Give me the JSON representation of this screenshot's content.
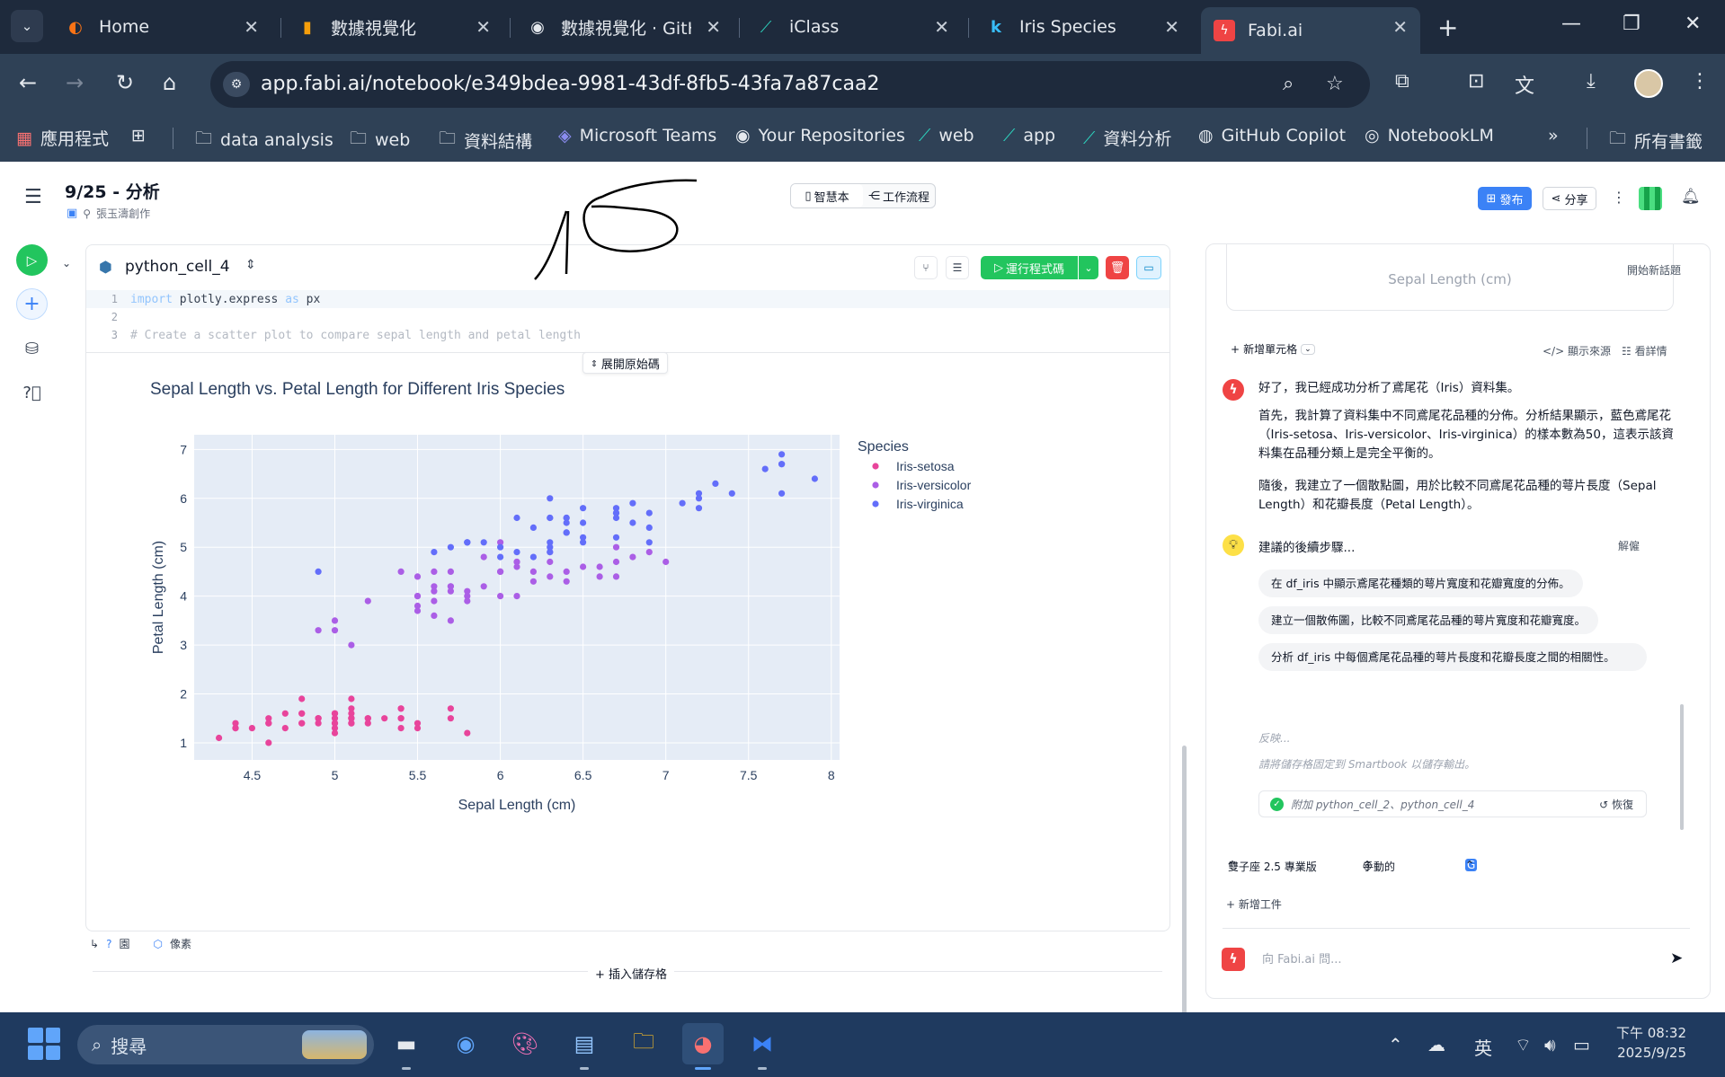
{
  "browser": {
    "tabs": [
      {
        "title": "Home",
        "icon": "home-tab-icon"
      },
      {
        "title": "數據視覺化",
        "icon": "book-icon"
      },
      {
        "title": "數據視覺化 · GitHub",
        "icon": "github-icon"
      },
      {
        "title": "iClass",
        "icon": "iclass-icon"
      },
      {
        "title": "Iris Species",
        "icon": "kaggle-icon"
      },
      {
        "title": "Fabi.ai",
        "icon": "fabi-icon"
      }
    ],
    "url": "app.fabi.ai/notebook/e349bdea-9981-43df-8fb5-43fa7a87caa2",
    "bookmarks": [
      {
        "label": "應用程式",
        "icon": "apps-grid-icon"
      },
      {
        "label": "data analysis",
        "icon": "folder-icon"
      },
      {
        "label": "web",
        "icon": "folder-icon"
      },
      {
        "label": "資料結構",
        "icon": "folder-icon"
      },
      {
        "label": "Microsoft Teams",
        "icon": "teams-icon"
      },
      {
        "label": "Your Repositories",
        "icon": "github-icon"
      },
      {
        "label": "web",
        "icon": "iclass-icon"
      },
      {
        "label": "app",
        "icon": "iclass-icon"
      },
      {
        "label": "資料分析",
        "icon": "iclass-icon"
      },
      {
        "label": "GitHub Copilot",
        "icon": "copilot-icon"
      },
      {
        "label": "NotebookLM",
        "icon": "notebooklm-icon"
      }
    ],
    "all_bookmarks": "所有書籤"
  },
  "app": {
    "notebook_title": "9/25 - 分析",
    "creator": "張玉濤創作",
    "view_tabs": [
      "智慧本",
      "工作流程"
    ],
    "publish": "發布",
    "share": "分享"
  },
  "cell": {
    "name": "python_cell_4",
    "run_label": "運行程式碼",
    "code_lines": [
      {
        "num": "1",
        "kw1": "import",
        "text1": " plotly.express ",
        "kw2": "as",
        "text2": " px"
      },
      {
        "num": "2",
        "text": ""
      },
      {
        "num": "3",
        "text": "# Create a scatter plot to compare sepal length and petal length"
      }
    ],
    "expand_source": "展開原始碼",
    "footer_ref": "園",
    "footer_pixels": "像素",
    "insert_cell": "插入儲存格"
  },
  "chart_data": {
    "type": "scatter",
    "title": "Sepal Length vs. Petal Length for Different Iris Species",
    "xlabel": "Sepal Length (cm)",
    "ylabel": "Petal Length (cm)",
    "xlim": [
      4.15,
      8.05
    ],
    "ylim": [
      0.65,
      7.3
    ],
    "xticks": [
      4.5,
      5,
      5.5,
      6,
      6.5,
      7,
      7.5,
      8
    ],
    "yticks": [
      1,
      2,
      3,
      4,
      5,
      6,
      7
    ],
    "grid": true,
    "legend_title": "Species",
    "legend_position": "top-right",
    "series": [
      {
        "name": "Iris-setosa",
        "color": "#e8449b",
        "points": [
          [
            5.1,
            1.4
          ],
          [
            4.9,
            1.4
          ],
          [
            4.7,
            1.3
          ],
          [
            4.6,
            1.5
          ],
          [
            5.0,
            1.4
          ],
          [
            5.4,
            1.7
          ],
          [
            4.6,
            1.4
          ],
          [
            5.0,
            1.5
          ],
          [
            4.4,
            1.4
          ],
          [
            4.9,
            1.5
          ],
          [
            5.4,
            1.5
          ],
          [
            4.8,
            1.6
          ],
          [
            4.8,
            1.4
          ],
          [
            4.3,
            1.1
          ],
          [
            5.8,
            1.2
          ],
          [
            5.7,
            1.5
          ],
          [
            5.4,
            1.3
          ],
          [
            5.1,
            1.4
          ],
          [
            5.7,
            1.7
          ],
          [
            5.1,
            1.5
          ],
          [
            5.4,
            1.7
          ],
          [
            5.1,
            1.5
          ],
          [
            4.6,
            1.0
          ],
          [
            5.1,
            1.7
          ],
          [
            4.8,
            1.9
          ],
          [
            5.0,
            1.6
          ],
          [
            5.0,
            1.6
          ],
          [
            5.2,
            1.5
          ],
          [
            5.2,
            1.4
          ],
          [
            4.7,
            1.6
          ],
          [
            4.8,
            1.6
          ],
          [
            5.4,
            1.5
          ],
          [
            5.2,
            1.5
          ],
          [
            5.5,
            1.4
          ],
          [
            4.9,
            1.5
          ],
          [
            5.0,
            1.2
          ],
          [
            5.5,
            1.3
          ],
          [
            4.9,
            1.5
          ],
          [
            4.4,
            1.3
          ],
          [
            5.1,
            1.5
          ],
          [
            5.0,
            1.3
          ],
          [
            4.5,
            1.3
          ],
          [
            4.4,
            1.3
          ],
          [
            5.0,
            1.6
          ],
          [
            5.1,
            1.9
          ],
          [
            4.8,
            1.4
          ],
          [
            5.1,
            1.6
          ],
          [
            4.6,
            1.4
          ],
          [
            5.3,
            1.5
          ],
          [
            5.0,
            1.4
          ]
        ]
      },
      {
        "name": "Iris-versicolor",
        "color": "#ab5ee6",
        "points": [
          [
            7.0,
            4.7
          ],
          [
            6.4,
            4.5
          ],
          [
            6.9,
            4.9
          ],
          [
            5.5,
            4.0
          ],
          [
            6.5,
            4.6
          ],
          [
            5.7,
            4.5
          ],
          [
            6.3,
            4.7
          ],
          [
            4.9,
            3.3
          ],
          [
            6.6,
            4.6
          ],
          [
            5.2,
            3.9
          ],
          [
            5.0,
            3.5
          ],
          [
            5.9,
            4.2
          ],
          [
            6.0,
            4.0
          ],
          [
            6.1,
            4.7
          ],
          [
            5.6,
            3.6
          ],
          [
            6.7,
            4.4
          ],
          [
            5.6,
            4.5
          ],
          [
            5.8,
            4.1
          ],
          [
            6.2,
            4.5
          ],
          [
            5.6,
            3.9
          ],
          [
            5.9,
            4.8
          ],
          [
            6.1,
            4.0
          ],
          [
            6.3,
            4.9
          ],
          [
            6.1,
            4.7
          ],
          [
            6.4,
            4.3
          ],
          [
            6.6,
            4.4
          ],
          [
            6.8,
            4.8
          ],
          [
            6.7,
            5.0
          ],
          [
            6.0,
            4.5
          ],
          [
            5.7,
            3.5
          ],
          [
            5.5,
            3.8
          ],
          [
            5.5,
            3.7
          ],
          [
            5.8,
            3.9
          ],
          [
            6.0,
            5.1
          ],
          [
            5.4,
            4.5
          ],
          [
            6.0,
            4.5
          ],
          [
            6.7,
            4.7
          ],
          [
            6.3,
            4.4
          ],
          [
            5.6,
            4.1
          ],
          [
            5.5,
            4.0
          ],
          [
            5.5,
            4.4
          ],
          [
            6.1,
            4.6
          ],
          [
            5.8,
            4.0
          ],
          [
            5.0,
            3.3
          ],
          [
            5.6,
            4.2
          ],
          [
            5.7,
            4.2
          ],
          [
            5.7,
            4.2
          ],
          [
            6.2,
            4.3
          ],
          [
            5.1,
            3.0
          ],
          [
            5.7,
            4.1
          ]
        ]
      },
      {
        "name": "Iris-virginica",
        "color": "#636efa",
        "points": [
          [
            6.3,
            6.0
          ],
          [
            5.8,
            5.1
          ],
          [
            7.1,
            5.9
          ],
          [
            6.3,
            5.6
          ],
          [
            6.5,
            5.8
          ],
          [
            7.6,
            6.6
          ],
          [
            4.9,
            4.5
          ],
          [
            7.3,
            6.3
          ],
          [
            6.7,
            5.8
          ],
          [
            7.2,
            6.1
          ],
          [
            6.5,
            5.1
          ],
          [
            6.4,
            5.3
          ],
          [
            6.8,
            5.5
          ],
          [
            5.7,
            5.0
          ],
          [
            5.8,
            5.1
          ],
          [
            6.4,
            5.3
          ],
          [
            6.5,
            5.5
          ],
          [
            7.7,
            6.7
          ],
          [
            7.7,
            6.9
          ],
          [
            6.0,
            5.0
          ],
          [
            6.9,
            5.7
          ],
          [
            5.6,
            4.9
          ],
          [
            7.7,
            6.7
          ],
          [
            6.3,
            4.9
          ],
          [
            6.7,
            5.7
          ],
          [
            7.2,
            6.0
          ],
          [
            6.2,
            4.8
          ],
          [
            6.1,
            4.9
          ],
          [
            6.4,
            5.6
          ],
          [
            7.2,
            5.8
          ],
          [
            7.4,
            6.1
          ],
          [
            7.9,
            6.4
          ],
          [
            6.4,
            5.6
          ],
          [
            6.3,
            5.1
          ],
          [
            6.1,
            5.6
          ],
          [
            7.7,
            6.1
          ],
          [
            6.3,
            5.6
          ],
          [
            6.4,
            5.5
          ],
          [
            6.0,
            4.8
          ],
          [
            6.9,
            5.4
          ],
          [
            6.7,
            5.6
          ],
          [
            6.9,
            5.1
          ],
          [
            5.8,
            5.1
          ],
          [
            6.8,
            5.9
          ],
          [
            6.7,
            5.7
          ],
          [
            6.7,
            5.2
          ],
          [
            6.3,
            5.0
          ],
          [
            6.5,
            5.2
          ],
          [
            6.2,
            5.4
          ],
          [
            5.9,
            5.1
          ]
        ]
      }
    ]
  },
  "chat": {
    "new_topic": "開始新話題",
    "prev_card_text": "Sepal Length (cm)",
    "add_cell": "新增單元格",
    "show_source": "顯示來源",
    "view_details": "看詳情",
    "message_p1": "好了，我已經成功分析了鳶尾花（Iris）資料集。",
    "message_p2": "首先，我計算了資料集中不同鳶尾花品種的分佈。分析結果顯示，藍色鳶尾花（Iris-setosa、Iris-versicolor、Iris-virginica）的樣本數為50，這表示該資料集在品種分類上是完全平衡的。",
    "message_p3": "隨後，我建立了一個散點圖，用於比較不同鳶尾花品種的萼片長度（Sepal Length）和花瓣長度（Petal Length）。",
    "tips_title": "建議的後續步驟...",
    "dismiss": "解僱",
    "suggestions": [
      "在 df_iris 中顯示鳶尾花種類的萼片寬度和花瓣寬度的分佈。",
      "建立一個散佈圖，比較不同鳶尾花品種的萼片寬度和花瓣寬度。",
      "分析 df_iris 中每個鳶尾花品種的萼片長度和花瓣長度之間的相關性。"
    ],
    "feedback": "反映...",
    "fix_note": "請將儲存格固定到 Smartbook 以儲存輸出。",
    "attachment": "附加 python_cell_2、python_cell_4",
    "restore": "恢復",
    "model": "雙子座 2.5 專業版",
    "mode": "手動的",
    "new_work": "新增工件",
    "ask_placeholder": "向 Fabi.ai 問..."
  },
  "taskbar": {
    "search": "搜尋",
    "ime": "英",
    "time": "下午 08:32",
    "date": "2025/9/25"
  }
}
